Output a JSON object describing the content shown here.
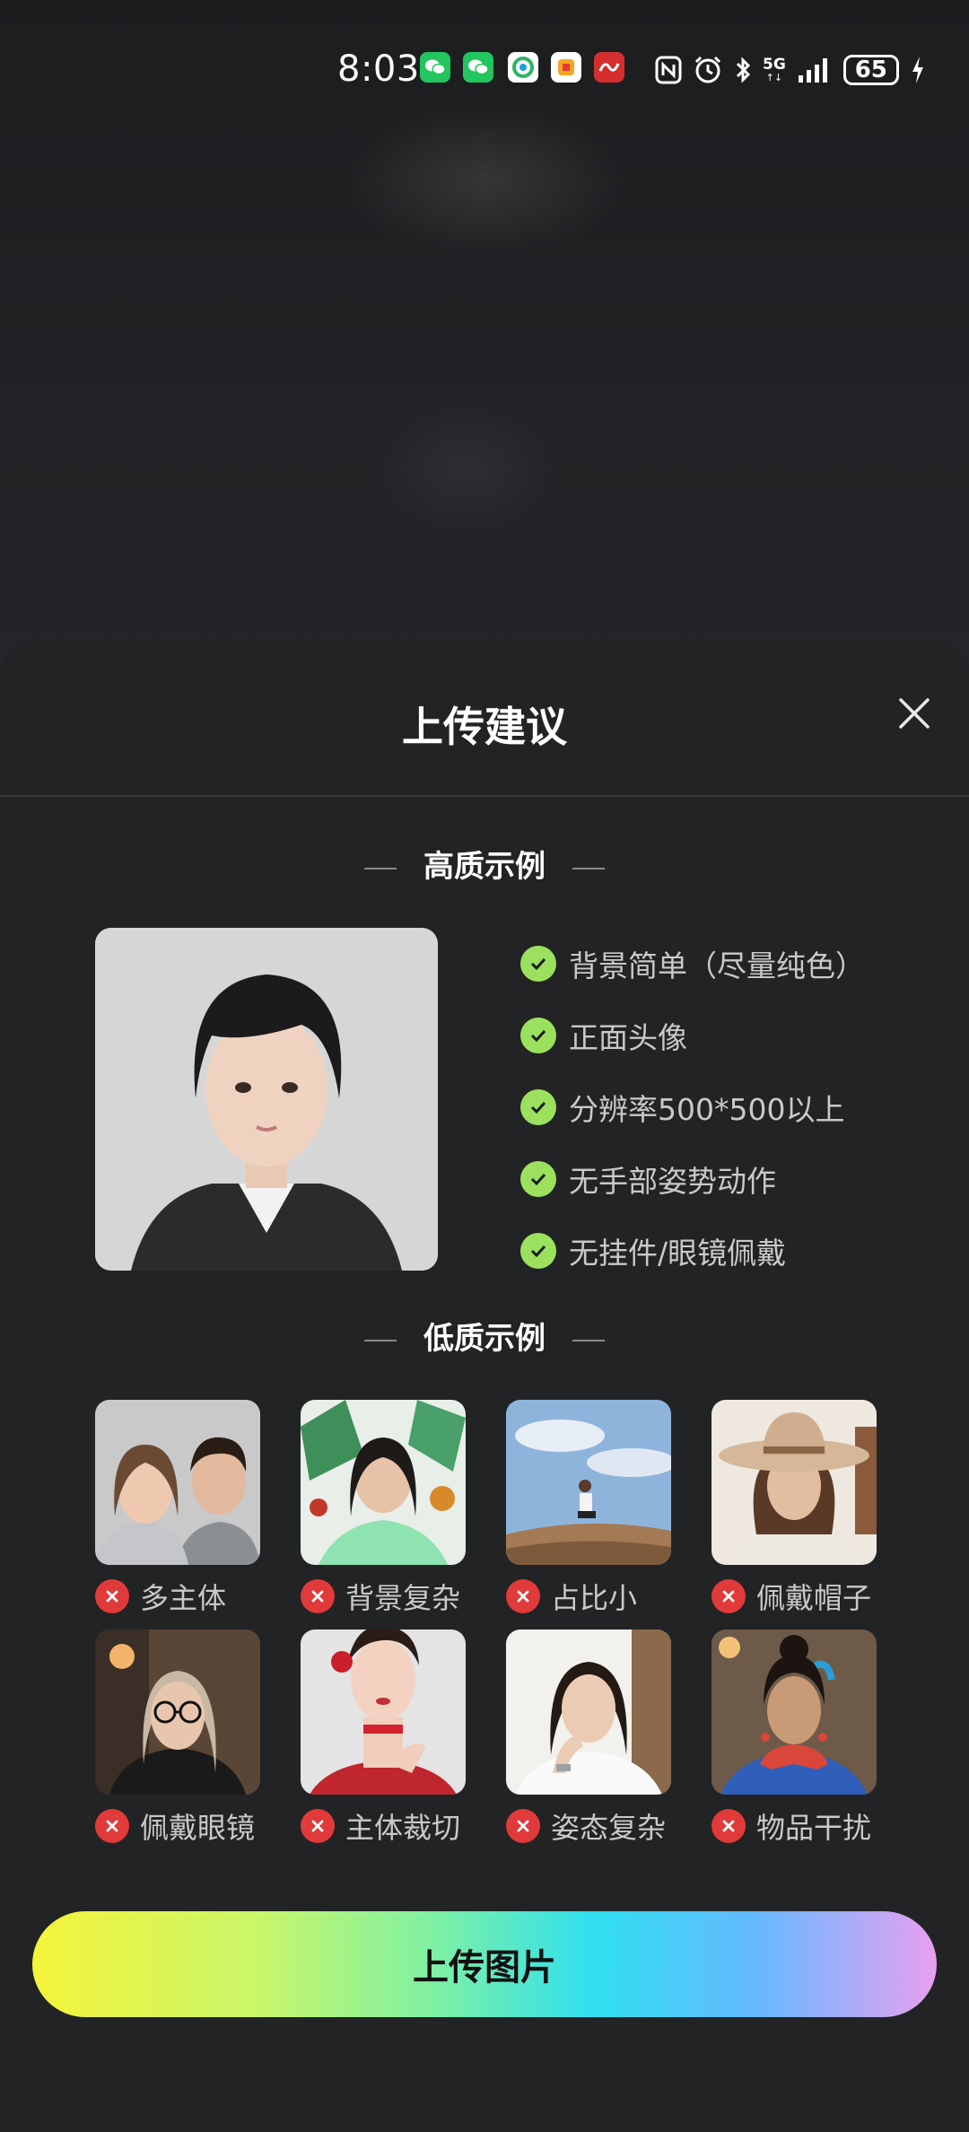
{
  "status_bar": {
    "time": "8:03",
    "battery": "65",
    "network": "5G",
    "icons": [
      "wechat-icon",
      "wechat-icon",
      "app-icon",
      "app-icon",
      "app-icon",
      "nfc-icon",
      "alarm-icon",
      "bluetooth-icon",
      "signal-icon",
      "battery-icon",
      "charging-icon"
    ]
  },
  "sheet": {
    "title": "上传建议",
    "close_icon": "close-icon"
  },
  "good_section": {
    "title": "高质示例",
    "items": [
      "背景简单（尽量纯色）",
      "正面头像",
      "分辨率500*500以上",
      "无手部姿势动作",
      "无挂件/眼镜佩戴"
    ]
  },
  "bad_section": {
    "title": "低质示例",
    "items": [
      {
        "label": "多主体"
      },
      {
        "label": "背景复杂"
      },
      {
        "label": "占比小"
      },
      {
        "label": "佩戴帽子"
      },
      {
        "label": "佩戴眼镜"
      },
      {
        "label": "主体裁切"
      },
      {
        "label": "姿态复杂"
      },
      {
        "label": "物品干扰"
      }
    ]
  },
  "upload_button": {
    "label": "上传图片"
  },
  "colors": {
    "check": "#9be15d",
    "cross": "#e03a3a",
    "sheet_bg": "#222325"
  }
}
